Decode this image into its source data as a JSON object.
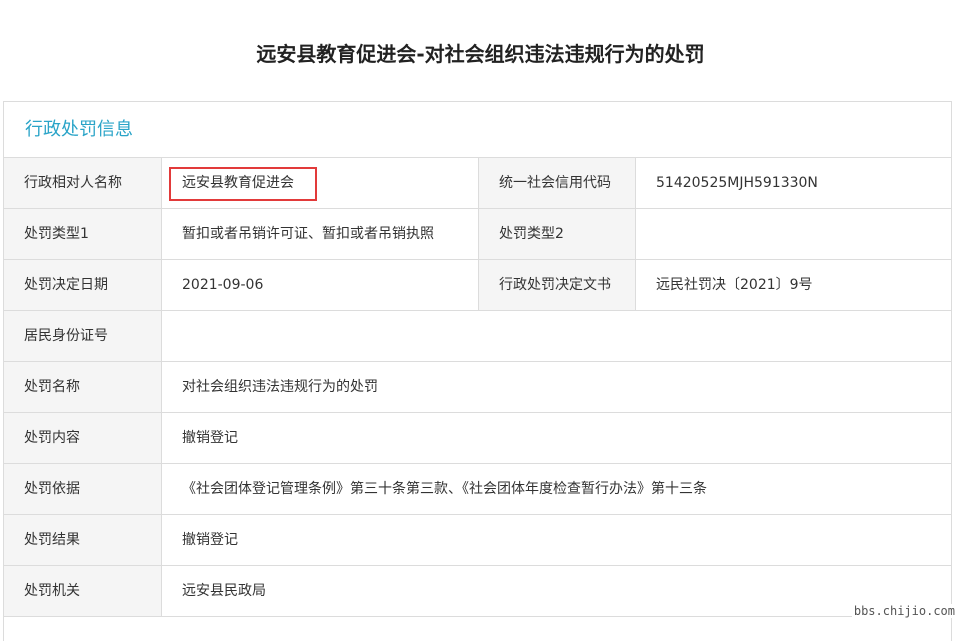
{
  "page": {
    "title": "远安县教育促进会-对社会组织违法违规行为的处罚"
  },
  "section": {
    "title": "行政处罚信息"
  },
  "fields": {
    "party_name_label": "行政相对人名称",
    "party_name_value": "远安县教育促进会",
    "credit_code_label": "统一社会信用代码",
    "credit_code_value": "51420525MJH591330N",
    "penalty_type1_label": "处罚类型1",
    "penalty_type1_value": "暂扣或者吊销许可证、暂扣或者吊销执照",
    "penalty_type2_label": "处罚类型2",
    "penalty_type2_value": "",
    "decision_date_label": "处罚决定日期",
    "decision_date_value": "2021-09-06",
    "decision_doc_label": "行政处罚决定文书",
    "decision_doc_value": "远民社罚决〔2021〕9号",
    "id_number_label": "居民身份证号",
    "id_number_value": "",
    "penalty_name_label": "处罚名称",
    "penalty_name_value": "对社会组织违法违规行为的处罚",
    "penalty_content_label": "处罚内容",
    "penalty_content_value": "撤销登记",
    "penalty_basis_label": "处罚依据",
    "penalty_basis_value": "《社会团体登记管理条例》第三十条第三款、《社会团体年度检查暂行办法》第十三条",
    "penalty_result_label": "处罚结果",
    "penalty_result_value": "撤销登记",
    "penalty_agency_label": "处罚机关",
    "penalty_agency_value": "远安县民政局"
  },
  "watermark": {
    "text": "bbs.chijio.com"
  },
  "colors": {
    "accent": "#2aa4c8",
    "highlight": "#e23a3a",
    "label_bg": "#f5f5f5",
    "border": "#dcdcdc"
  }
}
